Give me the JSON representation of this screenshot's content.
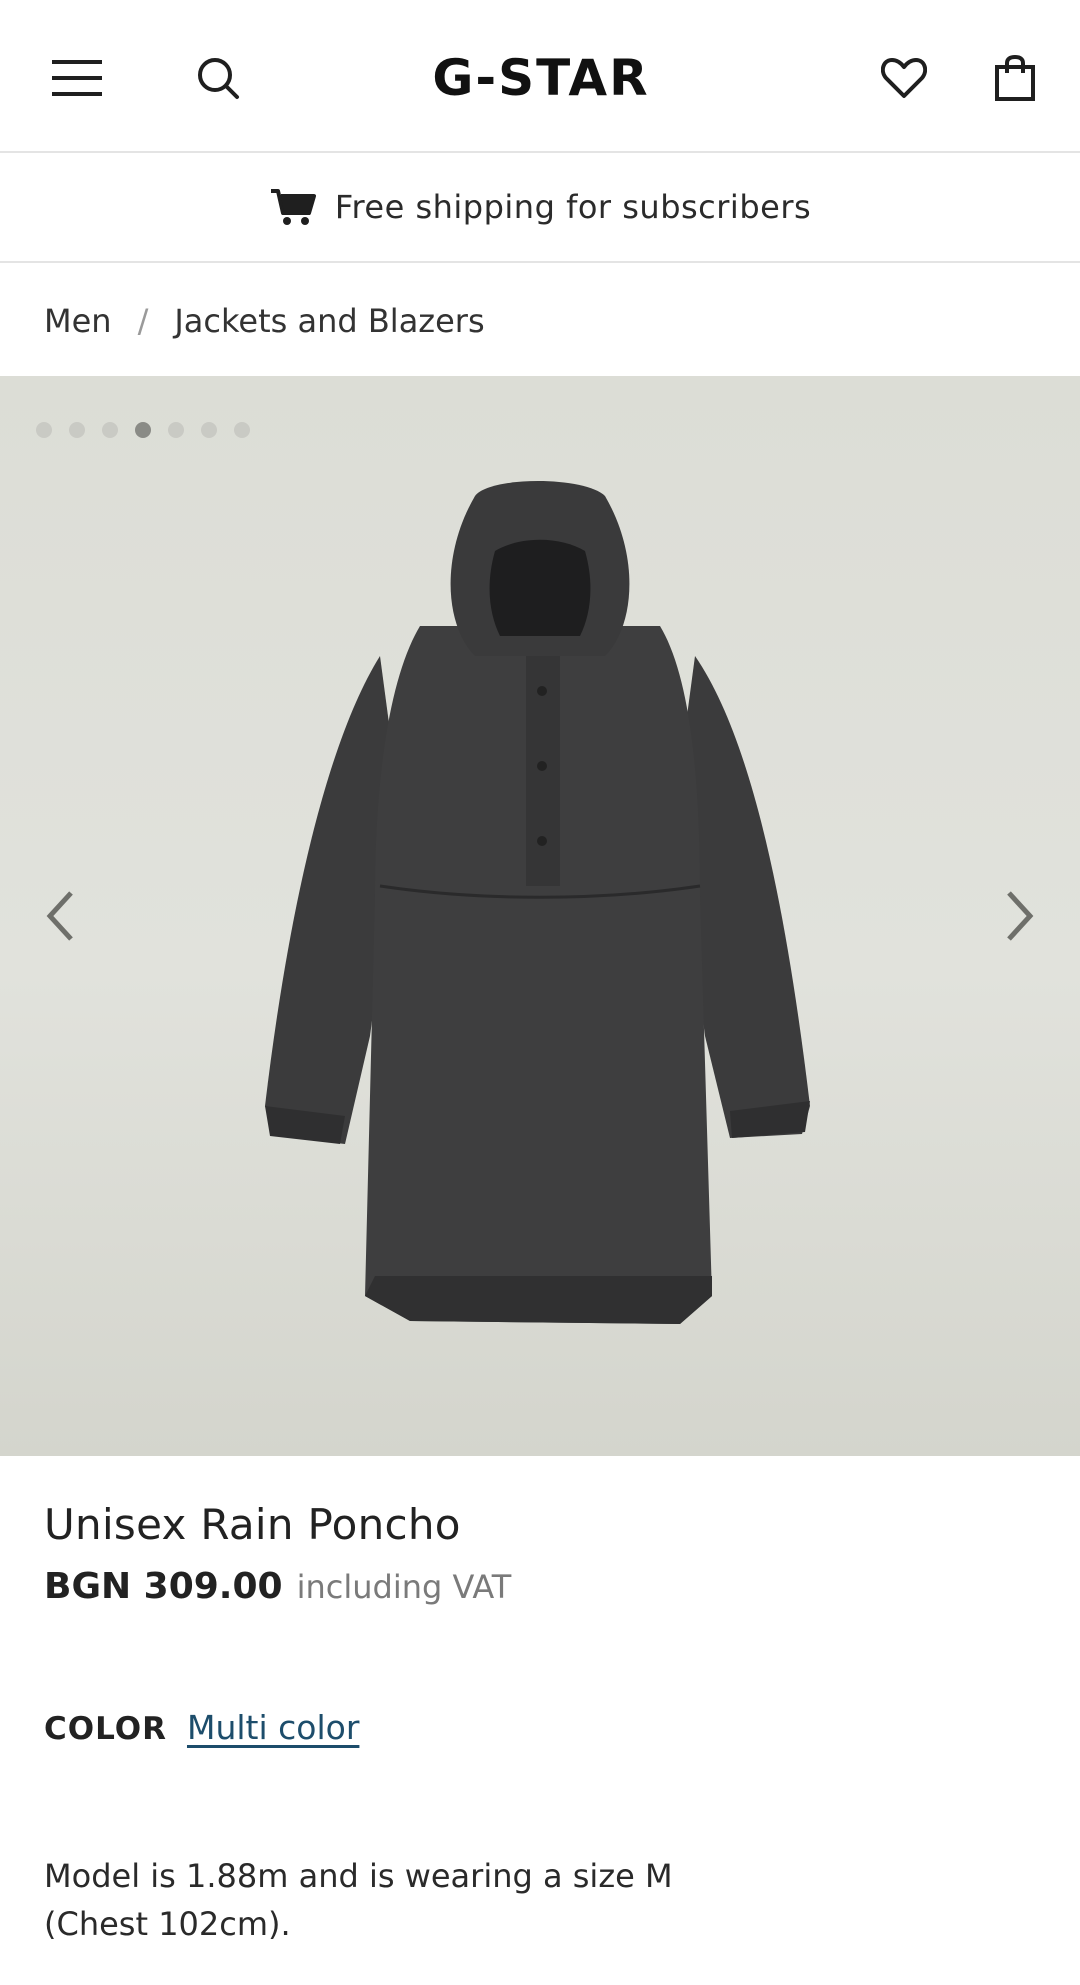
{
  "header": {
    "logo_text": "G-STAR",
    "icons": [
      "menu-icon",
      "search-icon",
      "heart-icon",
      "shopping-bag-icon"
    ]
  },
  "promo": {
    "text": "Free shipping for subscribers",
    "icon": "cart-icon"
  },
  "breadcrumb": {
    "items": [
      "Men",
      "Jackets and Blazers"
    ],
    "separator": "/"
  },
  "gallery": {
    "image_count": 7,
    "active_index": 3,
    "prev_glyph": "‹",
    "next_glyph": "›"
  },
  "product": {
    "title": "Unisex Rain Poncho",
    "price": "BGN 309.00",
    "price_note": "including VAT",
    "color_label": "COLOR",
    "color_value": "Multi color",
    "model_info_line1": "Model is 1.88m and is wearing a size M",
    "model_info_line2": "(Chest 102cm)."
  },
  "colors": {
    "link": "#1d4d6b",
    "gallery_bg": "#dcddd6",
    "garment": "#3a3a3b"
  }
}
